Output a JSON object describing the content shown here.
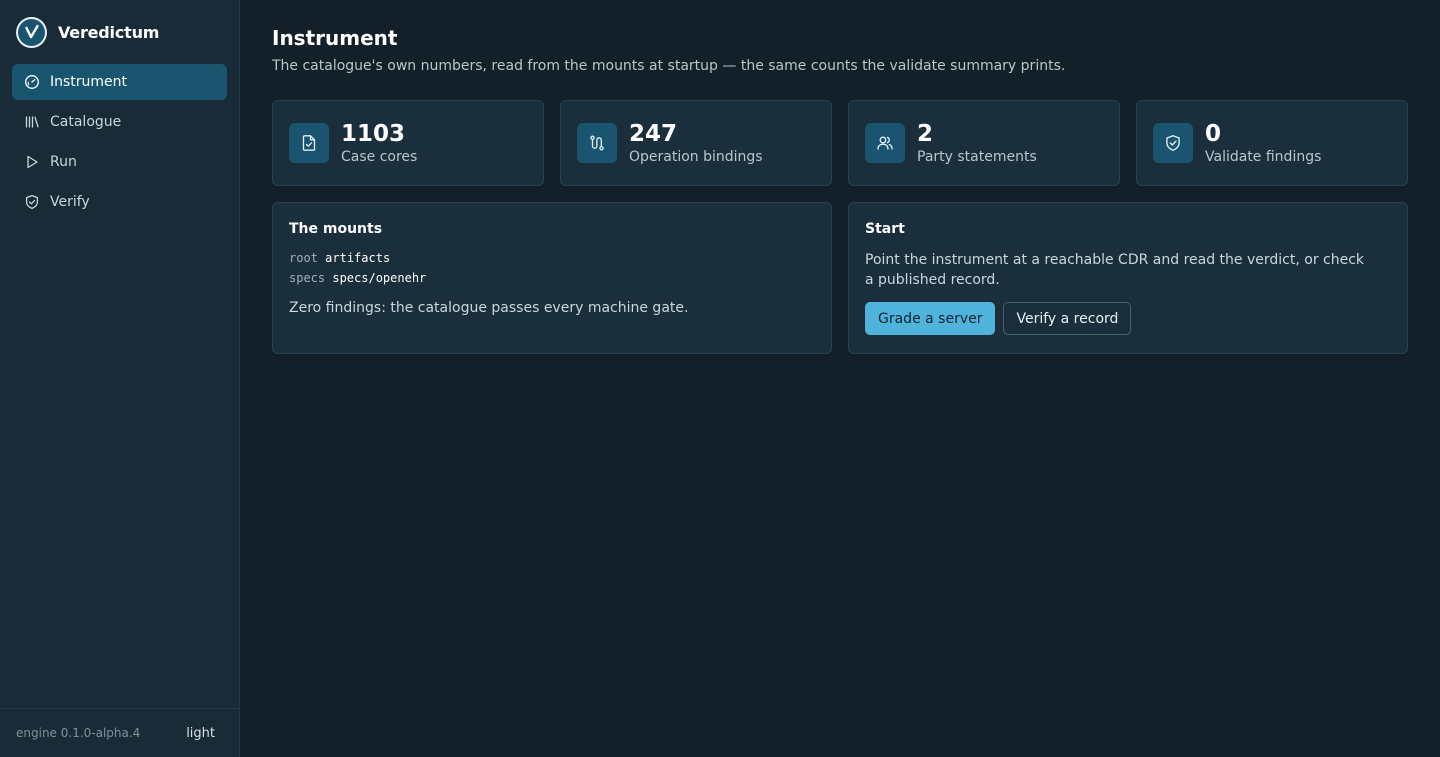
{
  "brand": {
    "name": "Veredictum",
    "logo_icon": "check-icon"
  },
  "nav": {
    "items": [
      {
        "label": "Instrument",
        "icon": "gauge-icon",
        "active": true
      },
      {
        "label": "Catalogue",
        "icon": "library-icon",
        "active": false
      },
      {
        "label": "Run",
        "icon": "play-icon",
        "active": false
      },
      {
        "label": "Verify",
        "icon": "shield-check-icon",
        "active": false
      }
    ]
  },
  "footer": {
    "engine": "engine 0.1.0-alpha.4",
    "theme_toggle": "light"
  },
  "page": {
    "title": "Instrument",
    "subtitle": "The catalogue's own numbers, read from the mounts at startup — the same counts the validate summary prints."
  },
  "stats": [
    {
      "value": "1103",
      "label": "Case cores",
      "icon": "file-check-icon"
    },
    {
      "value": "247",
      "label": "Operation bindings",
      "icon": "route-icon"
    },
    {
      "value": "2",
      "label": "Party statements",
      "icon": "users-icon"
    },
    {
      "value": "0",
      "label": "Validate findings",
      "icon": "shield-check-icon"
    }
  ],
  "mounts": {
    "title": "The mounts",
    "rows": [
      {
        "key": "root",
        "value": "artifacts"
      },
      {
        "key": "specs",
        "value": "specs/openehr"
      }
    ],
    "note": "Zero findings: the catalogue passes every machine gate."
  },
  "start": {
    "title": "Start",
    "text": "Point the instrument at a reachable CDR and read the verdict, or check a published record.",
    "primary_button": "Grade a server",
    "secondary_button": "Verify a record"
  },
  "colors": {
    "accent": "#4fb3dc",
    "active_nav": "#1a5570",
    "background": "#13202a",
    "sidebar": "#182b37",
    "card": "#1a2f3b"
  }
}
